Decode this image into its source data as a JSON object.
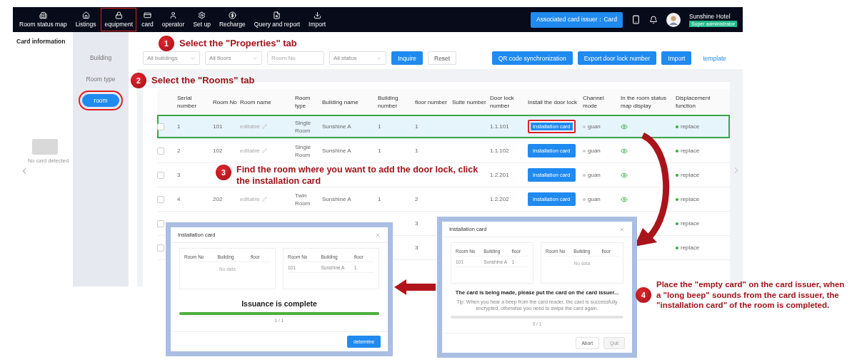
{
  "nav": {
    "items": [
      {
        "label": "Room status map",
        "highlighted": false
      },
      {
        "label": "Listings",
        "highlighted": false
      },
      {
        "label": "equipment",
        "highlighted": true
      },
      {
        "label": "card",
        "highlighted": false
      },
      {
        "label": "operator",
        "highlighted": false
      },
      {
        "label": "Set up",
        "highlighted": false
      },
      {
        "label": "Recharge",
        "highlighted": false
      },
      {
        "label": "Query and report",
        "highlighted": false
      },
      {
        "label": "Import",
        "highlighted": false
      }
    ],
    "issuer_button": "Associated card issuer：Card",
    "user": {
      "name": "Sunshine Hotel",
      "role": "Super administrator"
    }
  },
  "left_panel": {
    "title": "Card information",
    "status": "No card detected"
  },
  "sidebar": {
    "items": [
      {
        "label": "Building",
        "selected": false,
        "highlighted": false
      },
      {
        "label": "Room type",
        "selected": false,
        "highlighted": false
      },
      {
        "label": "room",
        "selected": true,
        "highlighted": true
      }
    ]
  },
  "filters": [
    {
      "kind": "select",
      "value": "All buildings"
    },
    {
      "kind": "select",
      "value": "All floors"
    },
    {
      "kind": "input",
      "placeholder": "Room No"
    },
    {
      "kind": "select",
      "value": "All status"
    }
  ],
  "filter_buttons": [
    {
      "label": "Inquire",
      "kind": "primary"
    },
    {
      "label": "Reset",
      "kind": "default"
    }
  ],
  "actions": [
    {
      "label": "QR code synchronization",
      "kind": "primary"
    },
    {
      "label": "Export door lock number",
      "kind": "primary"
    },
    {
      "label": "Import",
      "kind": "primary"
    },
    {
      "label": "template",
      "kind": "link"
    }
  ],
  "table": {
    "columns": [
      "Serial number",
      "Room No",
      "Room name",
      "Room type",
      "Building name",
      "Building number",
      "floor number",
      "Suite number",
      "Door lock number",
      "Install the door lock",
      "Channel mode",
      "In the room status map display",
      "Displacement function"
    ],
    "rows": [
      {
        "checked": false,
        "highlighted": true,
        "serial": "1",
        "room_no": "101",
        "room_name": "editable",
        "room_type": "Single Room",
        "building_name": "Sunshine A",
        "building_number": "1",
        "floor_number": "1",
        "door_lock_number": "1.1.101",
        "install_button": {
          "label": "Installation card",
          "highlighted": true
        },
        "channel": "guan",
        "map_display": true,
        "displacement": "replace"
      },
      {
        "checked": false,
        "highlighted": false,
        "serial": "2",
        "room_no": "102",
        "room_name": "editable",
        "room_type": "Single Room",
        "building_name": "Sunshine A",
        "building_number": "1",
        "floor_number": "1",
        "door_lock_number": "1.1.102",
        "install_button": {
          "label": "Installation card",
          "highlighted": false
        },
        "channel": "guan",
        "map_display": true,
        "displacement": "replace"
      },
      {
        "checked": false,
        "highlighted": false,
        "serial": "3",
        "door_lock_number": "1.2.201",
        "install_button": {
          "label": "Installation card",
          "highlighted": false
        },
        "channel": "guan",
        "map_display": true,
        "displacement": "replace"
      },
      {
        "checked": false,
        "highlighted": false,
        "serial": "4",
        "room_no": "202",
        "room_name": "editable",
        "room_type": "Twin Room",
        "building_name": "Sunshine A",
        "building_number": "1",
        "floor_number": "2",
        "door_lock_number": "1.2.202",
        "install_button": {
          "label": "Installation card",
          "highlighted": false
        },
        "channel": "guan",
        "map_display": true,
        "displacement": "replace"
      },
      {
        "checked": false,
        "highlighted": false,
        "floor_number": "3",
        "displacement": "replace"
      },
      {
        "checked": false,
        "highlighted": false,
        "floor_number": "3",
        "displacement": "replace"
      }
    ]
  },
  "dialogs": [
    {
      "title": "Installation card",
      "tables": [
        {
          "columns": [
            "Room No",
            "Building",
            "floor"
          ],
          "empty_text": "No data"
        },
        {
          "columns": [
            "Room No",
            "Building",
            "floor"
          ],
          "rows": [
            [
              "101",
              "Sunshine A",
              "1"
            ]
          ]
        }
      ],
      "status": "Issuance is complete",
      "progress": {
        "level": 1,
        "reading": "1 / 1"
      },
      "buttons": [
        {
          "label": "determine",
          "kind": "primary",
          "disabled": false
        }
      ]
    },
    {
      "title": "Installation card",
      "tables": [
        {
          "columns": [
            "Room No",
            "Building",
            "floor"
          ],
          "rows": [
            [
              "101",
              "Sunshine A",
              "1"
            ]
          ]
        },
        {
          "columns": [
            "Room No",
            "Building",
            "floor"
          ],
          "empty_text": "No data"
        }
      ],
      "status": "The card is being made, please put the card on the card issuer...",
      "tip": "Tip: When you hear a beep from the card reader, the card is successfully encrypted, otherwise you need to swipe the card again.",
      "progress": {
        "level": 0,
        "reading": "0 / 1"
      },
      "buttons": [
        {
          "label": "Abort",
          "kind": "default",
          "disabled": false
        },
        {
          "label": "Quit",
          "kind": "default",
          "disabled": true
        }
      ]
    }
  ],
  "annotations": [
    {
      "number": "1",
      "text": "Select the \"Properties\" tab"
    },
    {
      "number": "2",
      "text": "Select the \"Rooms\" tab"
    },
    {
      "number": "3",
      "text": "Find the room where you want to add the door lock, click the installation card"
    },
    {
      "number": "4",
      "text": "Place the \"empty card\" on the card issuer, when a \"long beep\" sounds from the card issuer, the \"installation card\" of the room is completed."
    }
  ]
}
